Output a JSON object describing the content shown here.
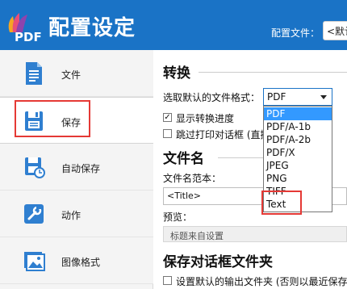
{
  "header": {
    "title": "配置设定",
    "config_label": "配置文件：",
    "config_value": "<默认>"
  },
  "sidebar": {
    "items": [
      {
        "label": "文件",
        "icon": "document-icon"
      },
      {
        "label": "保存",
        "icon": "save-icon"
      },
      {
        "label": "自动保存",
        "icon": "autosave-icon"
      },
      {
        "label": "动作",
        "icon": "wrench-icon"
      },
      {
        "label": "图像格式",
        "icon": "image-icon"
      }
    ]
  },
  "convert": {
    "title": "转换",
    "format_label": "选取默认的文件格式：",
    "format_value": "PDF",
    "show_progress_label": "显示转换进度",
    "show_progress_checked": true,
    "skip_print_label": "跳过打印对话框 (直接",
    "skip_print_checked": false
  },
  "format_options": [
    "PDF",
    "PDF/A-1b",
    "PDF/A-2b",
    "PDF/X",
    "JPEG",
    "PNG",
    "TIFF",
    "Text"
  ],
  "filename": {
    "title": "文件名",
    "template_label": "文件名范本：",
    "template_value": "<Title>",
    "preview_label": "预览：",
    "preview_value": "标题来自设置"
  },
  "save_dialog": {
    "title": "保存对话框文件夹",
    "default_folder_label": "设置默认的输出文件夹 (否则以最近保存",
    "default_folder_checked": false
  },
  "colors": {
    "header_bg": "#1a73c6",
    "highlight": "#e53935",
    "selected_option": "#3399ff"
  }
}
